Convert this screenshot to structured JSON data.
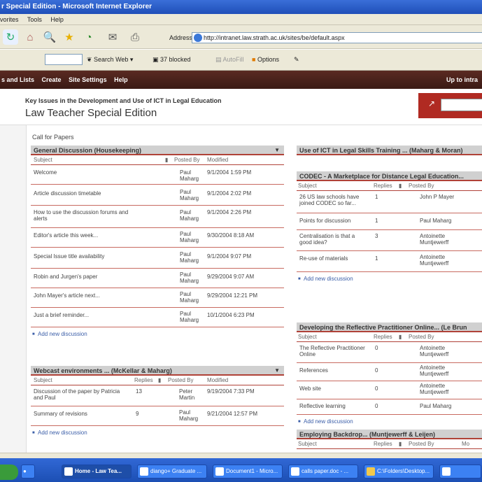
{
  "window": {
    "title": "r Special Edition - Microsoft Internet Explorer"
  },
  "menu": [
    "vorites",
    "Tools",
    "Help"
  ],
  "address": {
    "label": "Address",
    "url": "http://intranet.law.strath.ac.uk/sites/be/default.aspx"
  },
  "toolbar2": {
    "search_web": "Search Web",
    "blocked": "37 blocked",
    "autofill": "AutoFill",
    "options": "Options"
  },
  "sharepoint_nav": {
    "items": [
      "s and Lists",
      "Create",
      "Site Settings",
      "Help"
    ],
    "right": "Up to intra"
  },
  "site_header": {
    "subtitle": "Key Issues in the Development and Use of ICT in Legal Education",
    "title": "Law Teacher Special Edition"
  },
  "breadcrumb": "Call for Papers",
  "colors": {
    "accent": "#b02a22",
    "nav": "#4a2018"
  },
  "general": {
    "title": "General Discussion (Housekeeping)",
    "cols": {
      "subject": "Subject",
      "posted_by": "Posted By",
      "modified": "Modified"
    },
    "rows": [
      {
        "subject": "Welcome",
        "by": "Paul Maharg",
        "mod": "9/1/2004 1:59 PM"
      },
      {
        "subject": "Article discussion timetable",
        "by": "Paul Maharg",
        "mod": "9/1/2004 2:02 PM"
      },
      {
        "subject": "How to use the discussion forums and alerts",
        "by": "Paul Maharg",
        "mod": "9/1/2004 2:26 PM"
      },
      {
        "subject": "Editor's article this week...",
        "by": "Paul Maharg",
        "mod": "9/30/2004 8:18 AM"
      },
      {
        "subject": "Special Issue title availability",
        "by": "Paul Maharg",
        "mod": "9/1/2004 9:07 PM"
      },
      {
        "subject": "Robin and Jurgen's paper",
        "by": "Paul Maharg",
        "mod": "9/29/2004 9:07 AM"
      },
      {
        "subject": "John Mayer's article next...",
        "by": "Paul Maharg",
        "mod": "9/29/2004 12:21 PM"
      },
      {
        "subject": "Just a brief reminder...",
        "by": "Paul Maharg",
        "mod": "10/1/2004 6:23 PM"
      }
    ],
    "add_new": "Add new discussion"
  },
  "webcast": {
    "title": "Webcast environments ... (McKellar & Maharg)",
    "cols": {
      "subject": "Subject",
      "replies": "Replies",
      "posted_by": "Posted By",
      "modified": "Modified"
    },
    "rows": [
      {
        "subject": "Discussion of the paper by Patricia and Paul",
        "replies": "13",
        "by": "Peter Martin",
        "mod": "9/19/2004 7:33 PM"
      },
      {
        "subject": "Summary of revisions",
        "replies": "9",
        "by": "Paul Maharg",
        "mod": "9/21/2004 12:57 PM"
      }
    ],
    "add_new": "Add new discussion"
  },
  "ict": {
    "title": "Use of ICT in Legal Skills Training ... (Maharg & Moran)"
  },
  "codec": {
    "title": "CODEC - A Marketplace for Distance Legal Education...",
    "cols": {
      "subject": "Subject",
      "replies": "Replies",
      "posted_by": "Posted By"
    },
    "rows": [
      {
        "subject": "26 US law schools have joined CODEC so far...",
        "replies": "1",
        "by": "John P Mayer"
      },
      {
        "subject": "Points for discussion",
        "replies": "1",
        "by": "Paul Maharg"
      },
      {
        "subject": "Centralisation is that a good idea?",
        "replies": "3",
        "by": "Antoinette Muntjewerff"
      },
      {
        "subject": "Re-use of materials",
        "replies": "1",
        "by": "Antoinette Muntjewerff"
      }
    ],
    "add_new": "Add new discussion"
  },
  "reflective": {
    "title": "Developing the Reflective Practitioner Online... (Le Brun",
    "cols": {
      "subject": "Subject",
      "replies": "Replies",
      "posted_by": "Posted By"
    },
    "rows": [
      {
        "subject": "The Reflective Practitioner Online",
        "replies": "0",
        "by": "Antoinette Muntjewerff"
      },
      {
        "subject": "References",
        "replies": "0",
        "by": "Antoinette Muntjewerff"
      },
      {
        "subject": "Web site",
        "replies": "0",
        "by": "Antoinette Muntjewerff"
      },
      {
        "subject": "Reflective learning",
        "replies": "0",
        "by": "Paul Maharg"
      }
    ],
    "add_new": "Add new discussion"
  },
  "employing": {
    "title": "Employing Backdrop... (Muntjewerff & Leijen)",
    "cols": {
      "subject": "Subject",
      "replies": "Replies",
      "posted_by": "Posted By",
      "modified": "Mo"
    }
  },
  "taskbar": {
    "buttons": [
      "Home - Law Tea...",
      "diango+ Graduate ...",
      "Document1 - Micro...",
      "calls paper.doc - ...",
      "C:\\Folders\\Desktop..."
    ]
  }
}
